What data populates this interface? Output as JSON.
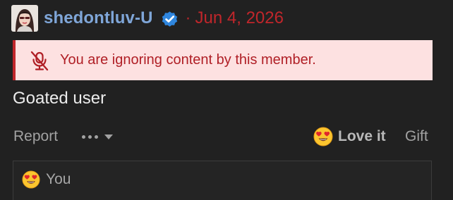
{
  "author": {
    "username": "shedontluv-U",
    "avatar_icon": "avatar-portrait",
    "verified_icon": "verified-check-icon",
    "separator": "·",
    "date": "Jun 4, 2026"
  },
  "ignored_notice": {
    "icon": "muted-mic-icon",
    "text": "You are ignoring content by this member."
  },
  "message": {
    "text": "Goated user"
  },
  "actions": {
    "report_label": "Report",
    "more_icon": "ellipsis-dropdown-icon",
    "love_label": "Love it",
    "love_icon": "heart-eyes-emoji-icon",
    "gift_label": "Gift"
  },
  "reactions": {
    "icon": "heart-eyes-emoji-icon",
    "text": "You"
  },
  "colors": {
    "background": "#212121",
    "username": "#7fa6d8",
    "date": "#c0262b",
    "notice_bg": "#fde1e1",
    "notice_border": "#c0262b",
    "notice_text": "#b01f26",
    "verified": "#2f86de"
  }
}
